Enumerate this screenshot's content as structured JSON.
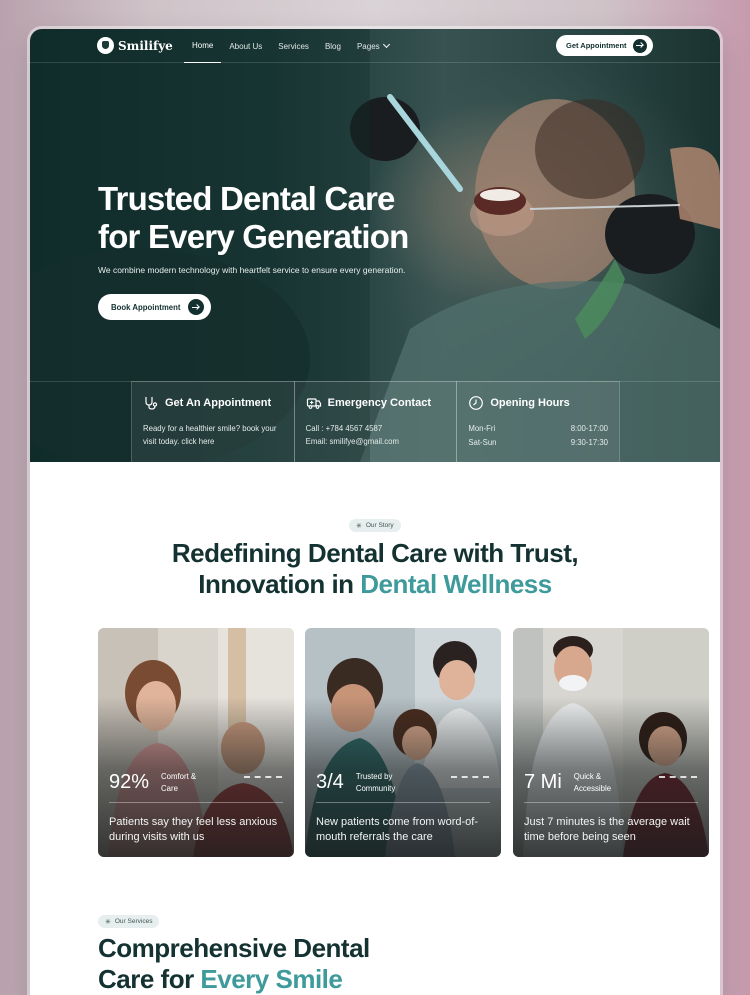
{
  "brand": {
    "name": "Smilifye"
  },
  "nav": {
    "items": [
      {
        "label": "Home",
        "active": true
      },
      {
        "label": "About Us",
        "active": false
      },
      {
        "label": "Services",
        "active": false
      },
      {
        "label": "Blog",
        "active": false
      },
      {
        "label": "Pages",
        "active": false
      }
    ],
    "cta_label": "Get Appointment"
  },
  "hero": {
    "title_line1": "Trusted Dental Care",
    "title_line2": "for Every Generation",
    "subtitle": "We combine modern technology with heartfelt service to ensure every generation.",
    "button_label": "Book Appointment"
  },
  "info_cards": {
    "appointment": {
      "title": "Get An Appointment",
      "text": "Ready for a healthier smile? book your visit today. click here",
      "icon": "stethoscope-icon"
    },
    "emergency": {
      "title": "Emergency Contact",
      "phone": "Call : +784 4567 4587",
      "email": "Email: smilifye@gmail.com",
      "icon": "ambulance-icon"
    },
    "hours": {
      "title": "Opening Hours",
      "icon": "clock-icon",
      "rows": [
        {
          "day": "Mon-Fri",
          "time": "8:00-17:00"
        },
        {
          "day": "Sat-Sun",
          "time": "9:30-17:30"
        }
      ]
    }
  },
  "story": {
    "pill": "Our Story",
    "title_line1": "Redefining Dental Care with Trust,",
    "title_line2_plain": "Innovation in ",
    "title_line2_accent": "Dental Wellness",
    "cards": [
      {
        "stat": "92%",
        "label_line1": "Comfort &",
        "label_line2": "Care",
        "description": "Patients say they feel less anxious during visits with us"
      },
      {
        "stat": "3/4",
        "label_line1": "Trusted by",
        "label_line2": "Community",
        "description": "New patients come from word-of-mouth referrals the care"
      },
      {
        "stat": "7 Mi",
        "label_line1": "Quick &",
        "label_line2": "Accessible",
        "description": "Just 7 minutes is the average wait time before being seen"
      }
    ]
  },
  "services": {
    "pill": "Our Services",
    "title_line1": "Comprehensive Dental",
    "title_line2_plain": "Care for ",
    "title_line2_accent": "Every Smile"
  },
  "colors": {
    "hero_dark": "#12302f",
    "accent": "#3e9a9b",
    "heading": "#143231"
  }
}
